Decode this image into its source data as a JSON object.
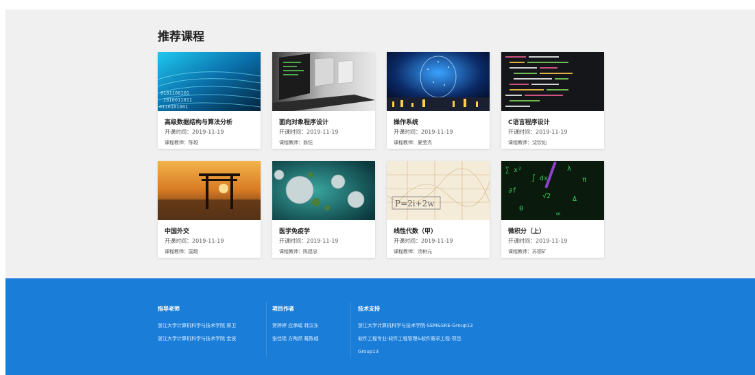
{
  "section_title": "推荐课程",
  "courses": [
    {
      "title": "高级数据结构与算法分析",
      "start": "开课时间：2019-11-19",
      "teacher": "课程教师：陈越"
    },
    {
      "title": "面向对象程序设计",
      "start": "开课时间：2019-11-19",
      "teacher": "课程教师：翁恺"
    },
    {
      "title": "操作系统",
      "start": "开课时间：2019-11-19",
      "teacher": "课程教师：夏莹杰"
    },
    {
      "title": "C语言程序设计",
      "start": "开课时间：2019-11-19",
      "teacher": "课程教师：沈钦仙"
    },
    {
      "title": "中国外交",
      "start": "开课时间：2019-11-19",
      "teacher": "课程教师：国超"
    },
    {
      "title": "医学免疫学",
      "start": "开课时间：2019-11-19",
      "teacher": "课程教师：陈建忠"
    },
    {
      "title": "线性代数（甲）",
      "start": "开课时间：2019-11-19",
      "teacher": "课程教师：汤树元"
    },
    {
      "title": "微积分（上）",
      "start": "开课时间：2019-11-19",
      "teacher": "课程教师：苏德矿"
    }
  ],
  "footer": {
    "col1": {
      "heading": "指导老师",
      "items": [
        "浙江大学计算机科学与技术学院 邢卫",
        "浙江大学计算机科学与技术学院 金波"
      ]
    },
    "col2": {
      "heading": "项目作者",
      "items": [
        "贺婷婷 应承峻 韩汉东",
        "张佳瑶 方陶然 戴陈威"
      ]
    },
    "col3": {
      "heading": "技术支持",
      "items": [
        "浙江大学计算机科学与技术学院-SEM&SRE-Group13",
        "软件工程专业-软件工程管理&软件需求工程-项目",
        "Group13"
      ]
    }
  },
  "thumb_formula": "P=2i+2w",
  "colors": {
    "footer_bg": "#1a7dd7",
    "page_bg": "#f0f0f0"
  }
}
